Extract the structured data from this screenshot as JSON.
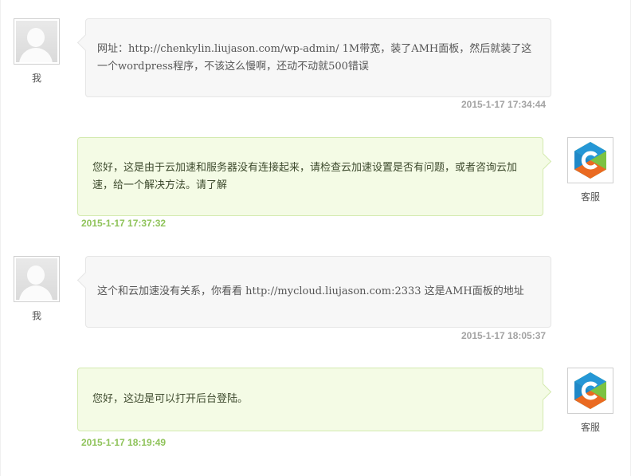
{
  "labels": {
    "me": "我",
    "agent": "客服"
  },
  "colors": {
    "user_bubble_bg": "#f7f7f7",
    "agent_bubble_bg": "#f4fbe5",
    "agent_time_color": "#8fc35a",
    "user_time_color": "#a3a3a3",
    "logo_blue": "#2597d6",
    "logo_green": "#7cc242",
    "logo_orange": "#ea6a21"
  },
  "messages": [
    {
      "sender": "me",
      "avatar_icon": "default-user-avatar-icon",
      "text": "网址：http://chenkylin.liujason.com/wp-admin/ 1M带宽，装了AMH面板，然后就装了这一个wordpress程序，不该这么慢啊，还动不动就500错误",
      "time": "2015-1-17 17:34:44"
    },
    {
      "sender": "agent",
      "avatar_icon": "support-logo-icon",
      "text": "您好，这是由于云加速和服务器没有连接起来，请检查云加速设置是否有问题，或者咨询云加速，给一个解决方法。请了解",
      "time": "2015-1-17 17:37:32"
    },
    {
      "sender": "me",
      "avatar_icon": "default-user-avatar-icon",
      "text": "这个和云加速没有关系，你看看 http://mycloud.liujason.com:2333 这是AMH面板的地址",
      "time": "2015-1-17 18:05:37"
    },
    {
      "sender": "agent",
      "avatar_icon": "support-logo-icon",
      "text": "您好，这边是可以打开后台登陆。",
      "time": "2015-1-17 18:19:49"
    }
  ]
}
